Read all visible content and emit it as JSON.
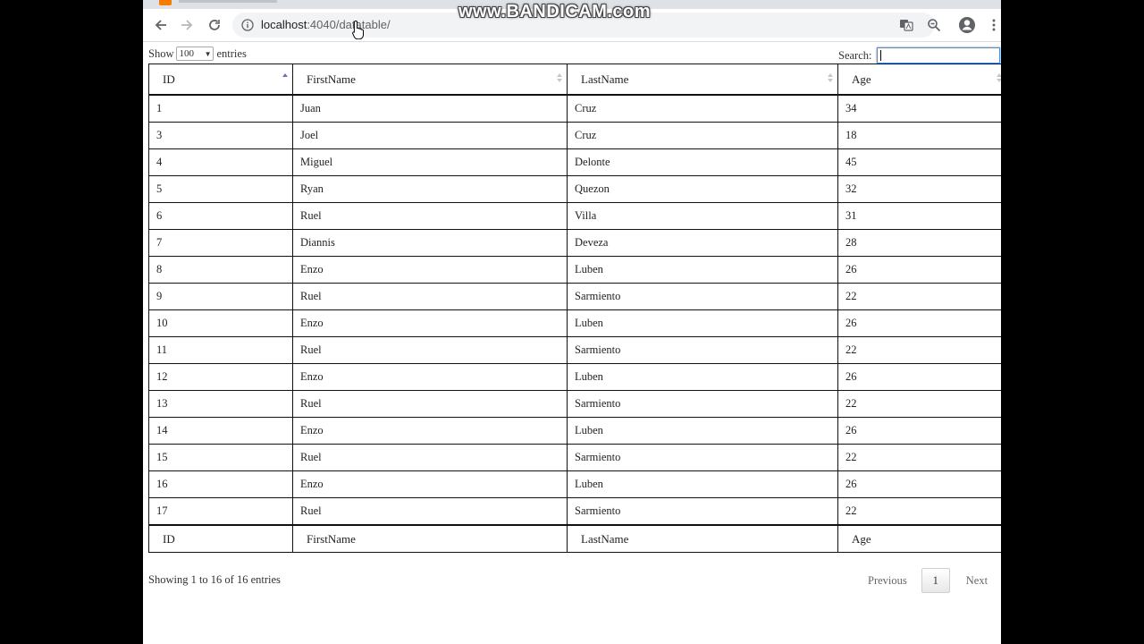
{
  "browser": {
    "url_host": "localhost",
    "url_path": ":4040/datatable/",
    "watermark": "www.BANDICAM.com"
  },
  "controls": {
    "show_label": "Show",
    "page_length": "100",
    "entries_label": "entries",
    "search_label": "Search:",
    "search_value": ""
  },
  "table": {
    "columns": [
      "ID",
      "FirstName",
      "LastName",
      "Age"
    ],
    "rows": [
      [
        "1",
        "Juan",
        "Cruz",
        "34"
      ],
      [
        "3",
        "Joel",
        "Cruz",
        "18"
      ],
      [
        "4",
        "Miguel",
        "Delonte",
        "45"
      ],
      [
        "5",
        "Ryan",
        "Quezon",
        "32"
      ],
      [
        "6",
        "Ruel",
        "Villa",
        "31"
      ],
      [
        "7",
        "Diannis",
        "Deveza",
        "28"
      ],
      [
        "8",
        "Enzo",
        "Luben",
        "26"
      ],
      [
        "9",
        "Ruel",
        "Sarmiento",
        "22"
      ],
      [
        "10",
        "Enzo",
        "Luben",
        "26"
      ],
      [
        "11",
        "Ruel",
        "Sarmiento",
        "22"
      ],
      [
        "12",
        "Enzo",
        "Luben",
        "26"
      ],
      [
        "13",
        "Ruel",
        "Sarmiento",
        "22"
      ],
      [
        "14",
        "Enzo",
        "Luben",
        "26"
      ],
      [
        "15",
        "Ruel",
        "Sarmiento",
        "22"
      ],
      [
        "16",
        "Enzo",
        "Luben",
        "26"
      ],
      [
        "17",
        "Ruel",
        "Sarmiento",
        "22"
      ]
    ]
  },
  "footer": {
    "info": "Showing 1 to 16 of 16 entries",
    "previous_label": "Previous",
    "current_page": "1",
    "next_label": "Next"
  },
  "icons": {
    "back": "arrow-left-icon",
    "forward": "arrow-right-icon",
    "reload": "reload-icon",
    "info": "info-icon",
    "translate": "translate-icon",
    "zoom": "zoom-icon",
    "profile": "account-icon",
    "menu": "kebab-menu-icon",
    "sort": "sort-icon"
  },
  "colors": {
    "sort_active": "#6a6ad9",
    "sort_inactive": "#c8c8c8",
    "search_focus": "#4a90d9"
  }
}
